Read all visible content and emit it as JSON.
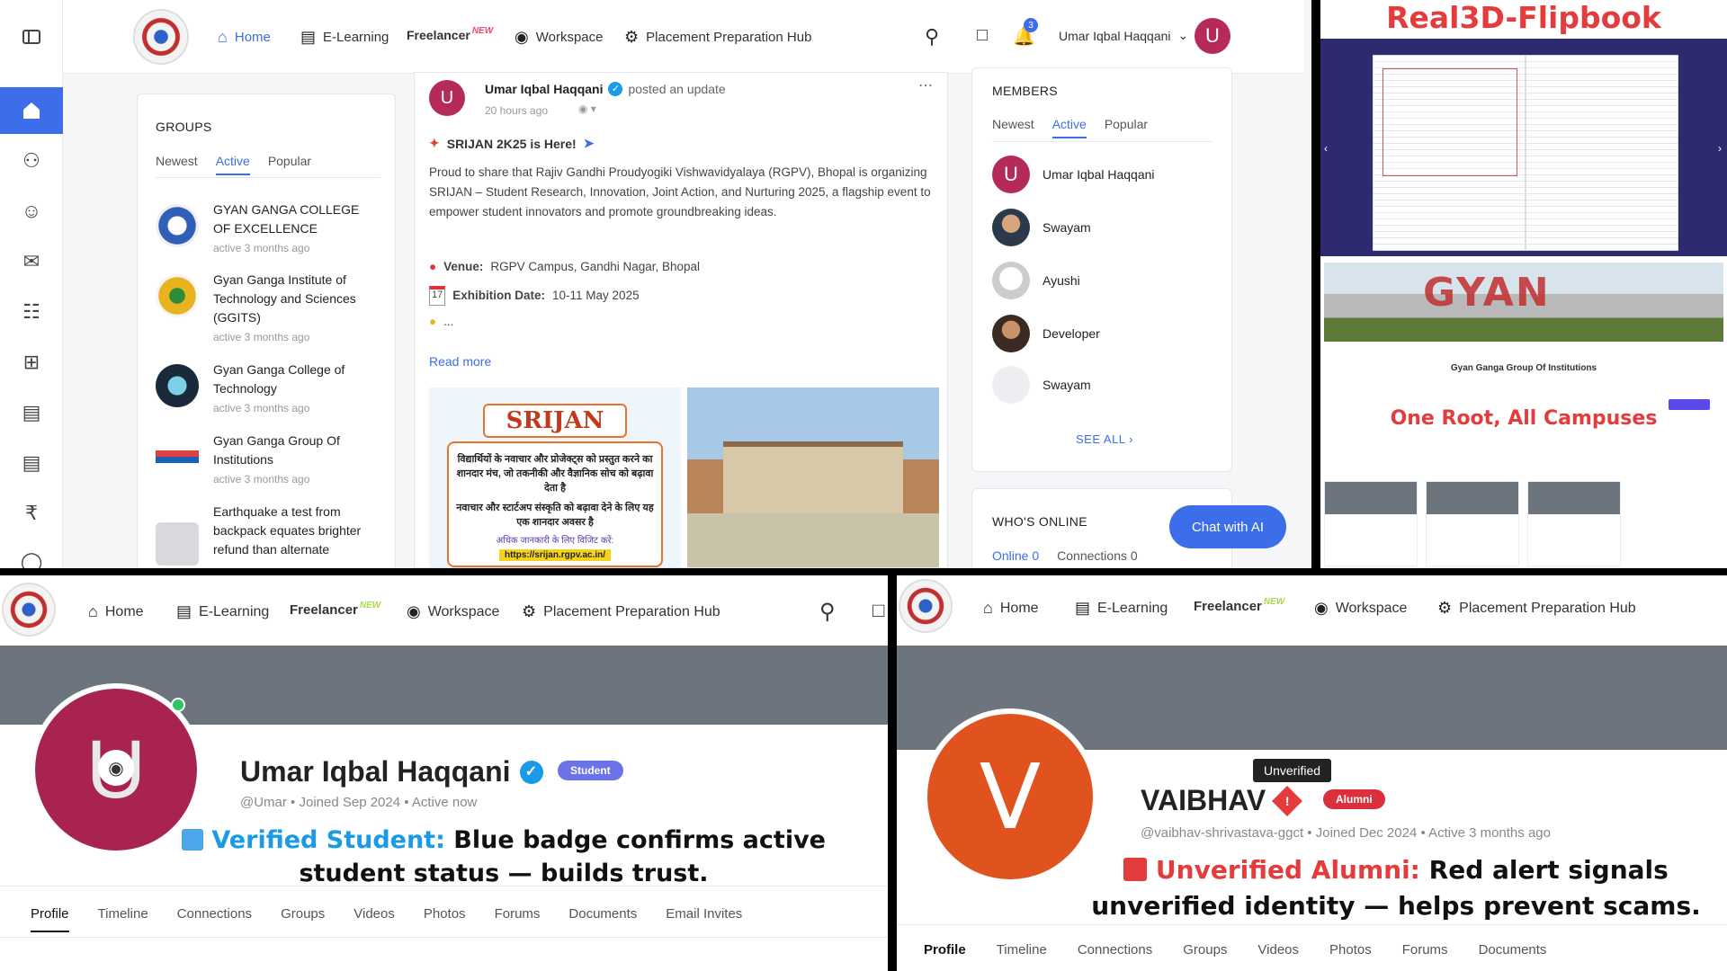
{
  "nav": {
    "home": "Home",
    "elearning": "E-Learning",
    "freelancer": "Freelancer",
    "new": "NEW",
    "workspace": "Workspace",
    "placement": "Placement Preparation Hub",
    "user_name": "Umar Iqbal Haqqani",
    "user_initial": "U",
    "notif_count": "3"
  },
  "groups": {
    "title": "GROUPS",
    "tabs": [
      "Newest",
      "Active",
      "Popular"
    ],
    "items": [
      {
        "name": "GYAN GANGA COLLEGE OF EXCELLENCE",
        "sub": "active 3 months ago"
      },
      {
        "name": "Gyan Ganga Institute of Technology and Sciences (GGITS)",
        "sub": "active 3 months ago"
      },
      {
        "name": "Gyan Ganga College of Technology",
        "sub": "active 3 months ago"
      },
      {
        "name": "Gyan Ganga Group Of Institutions",
        "sub": "active 3 months ago"
      },
      {
        "name": "Earthquake a test from backpack equates brighter refund than alternate",
        "sub": ""
      }
    ]
  },
  "post": {
    "author": "Umar Iqbal Haqqani",
    "action": "posted an update",
    "time": "20 hours ago",
    "headline": "SRIJAN 2K25 is Here!",
    "body": "Proud to share that Rajiv Gandhi Proudyogiki Vishwavidyalaya (RGPV), Bhopal is organizing SRIJAN – Student Research, Innovation, Joint Action, and Nurturing 2025, a flagship event to empower student innovators and promote groundbreaking ideas.",
    "venue_label": "Venue:",
    "venue": "RGPV Campus, Gandhi Nagar, Bhopal",
    "date_label": "Exhibition Date:",
    "date": "10-11 May 2025",
    "more": "...",
    "read_more": "Read more",
    "poster_title": "SRIJAN",
    "poster_line1": "विद्यार्थियों के नवाचार और प्रोजेक्ट्स को प्रस्तुत करने का शानदार मंच, जो तकनीकी और वैज्ञानिक सोच को बढ़ावा देता है",
    "poster_line2": "नवाचार और स्टार्टअप संस्कृति को बढ़ावा देने के लिए यह एक शानदार अवसर है",
    "poster_line3": "अधिक जानकारी के लिए विजिट करें:",
    "poster_url": "https://srijan.rgpv.ac.in/"
  },
  "members": {
    "title": "MEMBERS",
    "tabs": [
      "Newest",
      "Active",
      "Popular"
    ],
    "items": [
      "Umar Iqbal Haqqani",
      "Swayam",
      "Ayushi",
      "Developer",
      "Swayam"
    ],
    "see_all": "SEE ALL"
  },
  "online": {
    "title": "WHO'S ONLINE",
    "tab1": "Online 0",
    "tab2": "Connections 0"
  },
  "chat": "Chat with AI",
  "flipbook": {
    "title": "Real3D-Flipbook",
    "group_name": "Gyan Ganga Group Of Institutions",
    "tagline": "One Root, All Campuses"
  },
  "profile_student": {
    "name": "Umar Iqbal Haqqani",
    "initial": "U",
    "badge": "Student",
    "meta": "@Umar • Joined Sep 2024 • Active now",
    "caption_label": "Verified Student:",
    "caption_text": "Blue badge confirms active student status — builds trust.",
    "tabs": [
      "Profile",
      "Timeline",
      "Connections",
      "Groups",
      "Videos",
      "Photos",
      "Forums",
      "Documents",
      "Email Invites"
    ]
  },
  "profile_alumni": {
    "name": "VAIBHAV",
    "initial": "V",
    "tooltip": "Unverified",
    "badge": "Alumni",
    "meta": "@vaibhav-shrivastava-ggct • Joined Dec 2024 • Active 3 months ago",
    "caption_label": "Unverified Alumni:",
    "caption_text": "Red alert signals unverified identity — helps prevent scams.",
    "tabs": [
      "Profile",
      "Timeline",
      "Connections",
      "Groups",
      "Videos",
      "Photos",
      "Forums",
      "Documents"
    ]
  },
  "colors": {
    "accent": "#3b6ee8",
    "student_badge": "#6c72e8",
    "alumni_badge": "#dc2f3c",
    "alert_red": "#e43c3c",
    "verified_blue": "#1b9ae6"
  }
}
